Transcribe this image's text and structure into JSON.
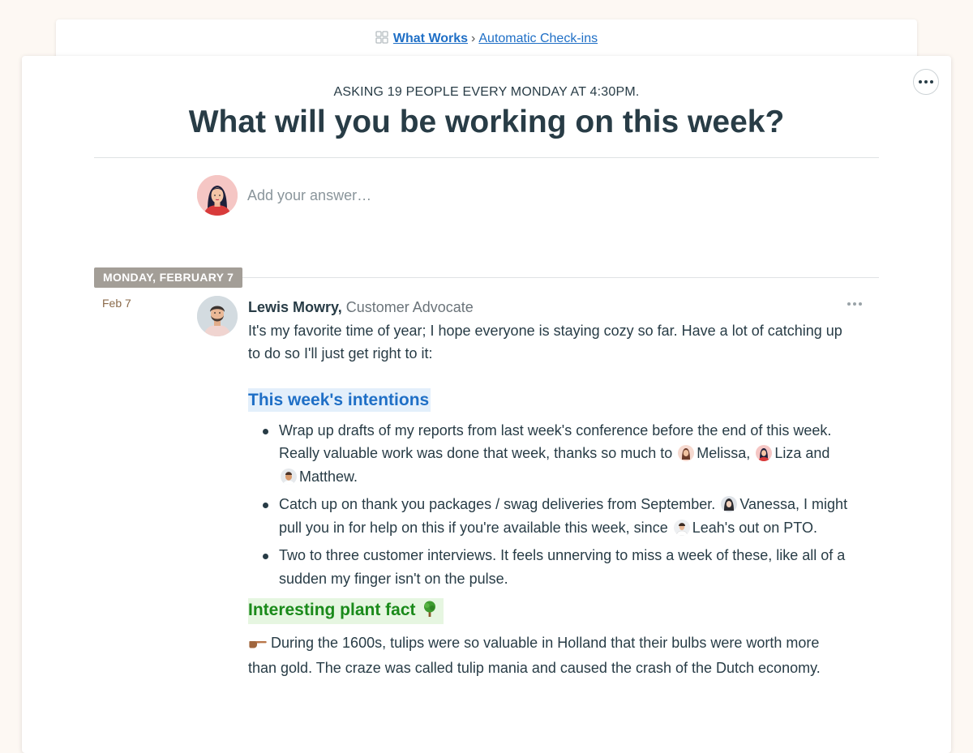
{
  "breadcrumb": {
    "project": "What Works",
    "separator": "›",
    "tool": "Automatic Check-ins"
  },
  "checkin": {
    "schedule": "ASKING 19 PEOPLE EVERY MONDAY AT 4:30PM.",
    "question": "What will you be working on this week?",
    "answer_placeholder": "Add your answer…"
  },
  "day": {
    "badge": "MONDAY, FEBRUARY 7",
    "date_short": "Feb 7"
  },
  "post": {
    "author": "Lewis Mowry,",
    "role": "Customer Advocate",
    "intro": "It's my favorite time of year; I hope everyone is staying cozy so far. Have a lot of catching up to do so I'll just get right to it:",
    "heading_intentions": "This week's intentions",
    "bullet1": {
      "text_a": "Wrap up drafts of my reports from last week's conference before the end of this week. Really valuable work was done that week, thanks so much to",
      "mention_a": "Melissa,",
      "mention_b": "Liza",
      "text_b": "and",
      "mention_c": "Matthew."
    },
    "bullet2": {
      "text_a": "Catch up on thank you packages / swag deliveries from September.",
      "mention_a": "Vanessa,",
      "text_b": "I might pull you in for help on this if you're available this week, since",
      "mention_b": "Leah's",
      "text_c": "out on PTO."
    },
    "bullet3": "Two to three customer interviews. It feels unnerving to miss a week of these, like all of a sudden my finger isn't on the pulse.",
    "heading_plant": "Interesting plant fact",
    "fact": "During the 1600s, tulips were so valuable in Holland that their bulbs were worth more than gold. The craze was called tulip mania and caused the crash of the Dutch economy."
  },
  "colors": {
    "link_blue": "#1f6fc6",
    "heading_green": "#1a8a1a",
    "badge_bg": "#a39e97",
    "page_bg": "#fdf8f3"
  },
  "icons": [
    "grid-icon",
    "options-icon",
    "tree-emoji-icon",
    "pointing-hand-icon"
  ]
}
